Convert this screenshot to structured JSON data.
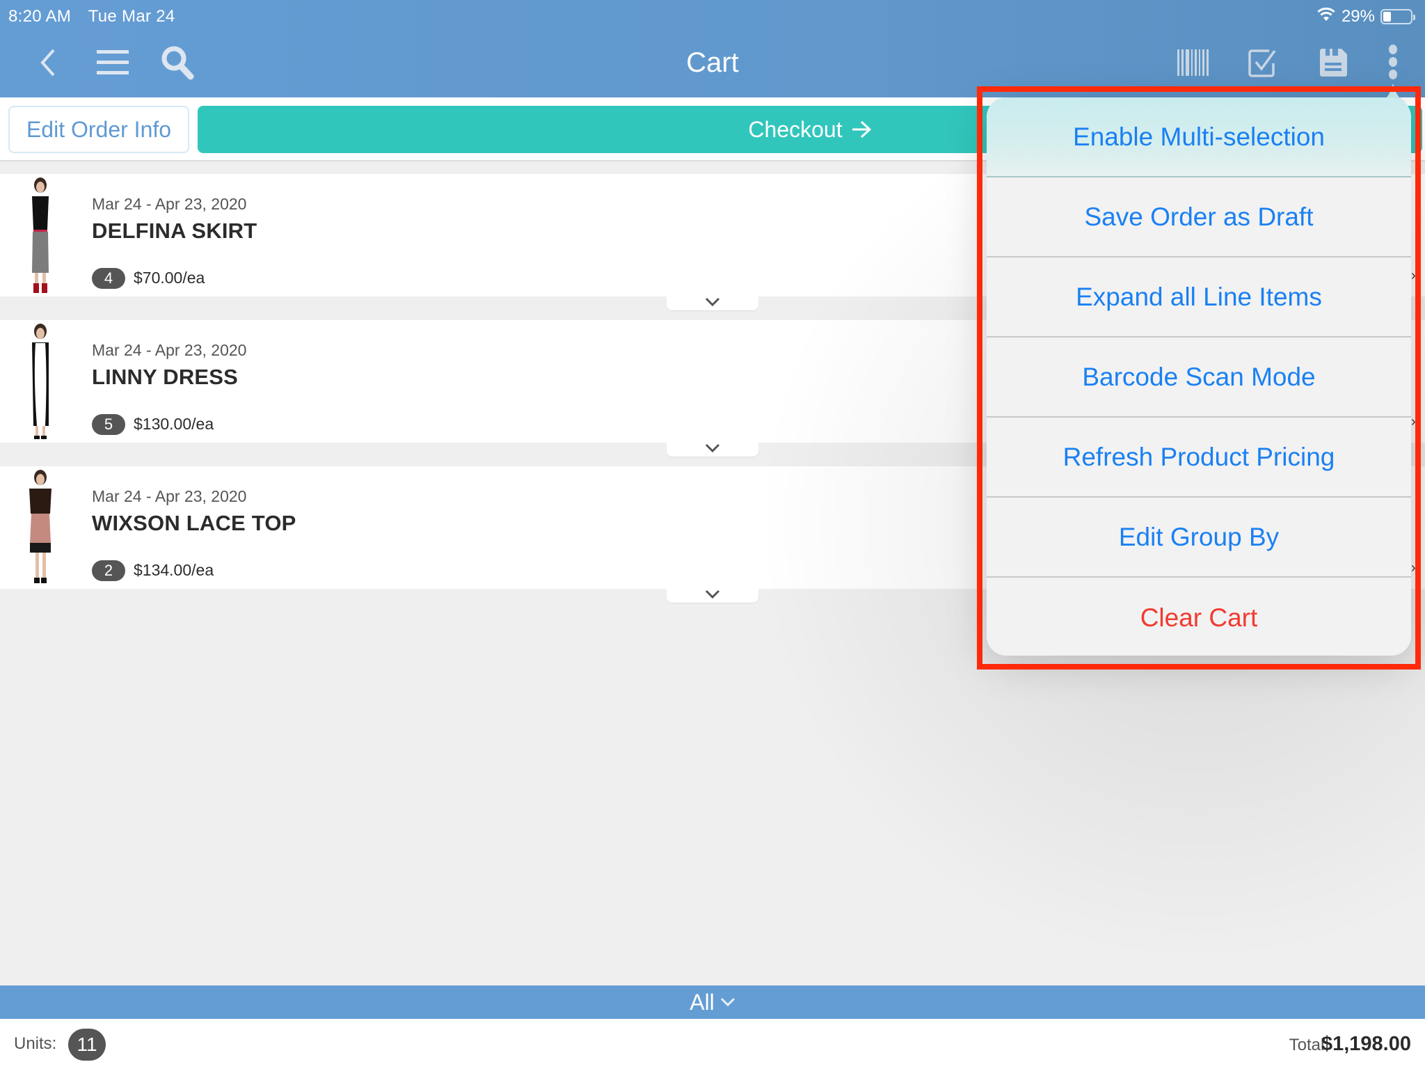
{
  "status_bar": {
    "time": "8:20 AM",
    "date": "Tue Mar 24",
    "wifi_icon": "wifi-icon",
    "battery_percent": "29%",
    "battery_level": 0.29
  },
  "nav": {
    "title": "Cart",
    "left_icons": [
      "back-chevron-icon",
      "hamburger-menu-icon",
      "search-icon"
    ],
    "right_icons": [
      "barcode-icon",
      "checkbox-icon",
      "save-floppy-icon",
      "more-vertical-icon"
    ]
  },
  "actions": {
    "edit_order_info": "Edit Order Info",
    "checkout": "Checkout",
    "checkout_icon": "arrow-right-icon"
  },
  "colors": {
    "nav_blue": "#649dd4",
    "checkout_teal": "#31c6bc",
    "menu_link_blue": "#1a80f2",
    "destructive_red": "#f23a2f",
    "highlight_red": "#ff2a0a",
    "badge_gray": "#555555"
  },
  "cart_items": [
    {
      "dates": "Mar 24 - Apr 23, 2020",
      "name": "DELFINA SKIRT",
      "quantity": "4",
      "price": "$70.00/ea"
    },
    {
      "dates": "Mar 24 - Apr 23, 2020",
      "name": "LINNY DRESS",
      "quantity": "5",
      "price": "$130.00/ea"
    },
    {
      "dates": "Mar 24 - Apr 23, 2020",
      "name": "WIXSON LACE TOP",
      "quantity": "2",
      "price": "$134.00/ea"
    }
  ],
  "group_filter": {
    "label": "All",
    "icon": "chevron-down-icon"
  },
  "footer": {
    "units_label": "Units:",
    "units_value": "11",
    "total_label": "Total:",
    "total_value": "$1,198.00"
  },
  "menu": {
    "items": [
      {
        "label": "Enable Multi-selection"
      },
      {
        "label": "Save Order as Draft"
      },
      {
        "label": "Expand all Line Items"
      },
      {
        "label": "Barcode Scan Mode"
      },
      {
        "label": "Refresh Product Pricing"
      },
      {
        "label": "Edit Group By"
      },
      {
        "label": "Clear Cart",
        "destructive": true
      }
    ]
  }
}
